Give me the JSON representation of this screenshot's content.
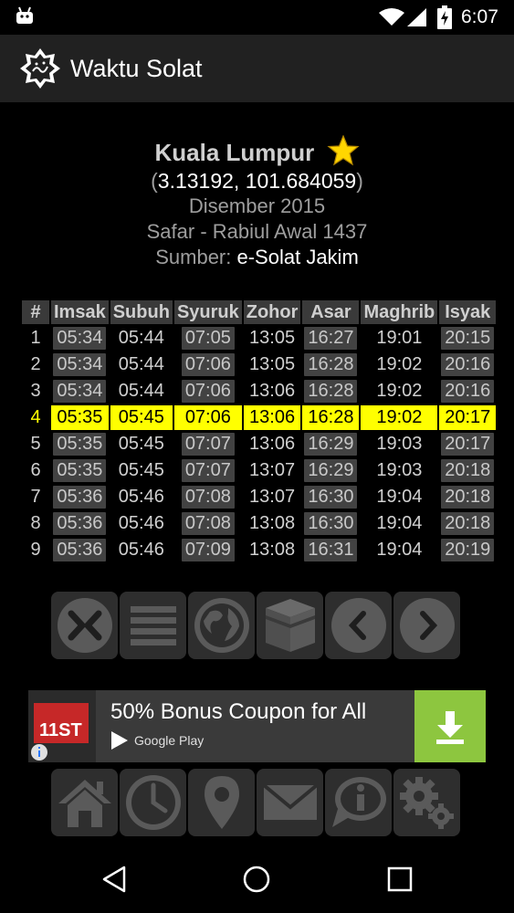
{
  "status_bar": {
    "time": "6:07"
  },
  "app_bar": {
    "title": "Waktu Solat"
  },
  "location": {
    "city": "Kuala Lumpur",
    "coordinates": "3.13192, 101.684059",
    "month": "Disember 2015",
    "hijri": "Safar - Rabiul Awal 1437",
    "source_label": "Sumber:",
    "source_value": "e-Solat Jakim"
  },
  "table": {
    "headers": [
      "#",
      "Imsak",
      "Subuh",
      "Syuruk",
      "Zohor",
      "Asar",
      "Maghrib",
      "Isyak"
    ],
    "rows": [
      [
        "1",
        "05:34",
        "05:44",
        "07:05",
        "13:05",
        "16:27",
        "19:01",
        "20:15"
      ],
      [
        "2",
        "05:34",
        "05:44",
        "07:06",
        "13:05",
        "16:28",
        "19:02",
        "20:16"
      ],
      [
        "3",
        "05:34",
        "05:44",
        "07:06",
        "13:06",
        "16:28",
        "19:02",
        "20:16"
      ],
      [
        "4",
        "05:35",
        "05:45",
        "07:06",
        "13:06",
        "16:28",
        "19:02",
        "20:17"
      ],
      [
        "5",
        "05:35",
        "05:45",
        "07:07",
        "13:06",
        "16:29",
        "19:03",
        "20:17"
      ],
      [
        "6",
        "05:35",
        "05:45",
        "07:07",
        "13:07",
        "16:29",
        "19:03",
        "20:18"
      ],
      [
        "7",
        "05:36",
        "05:46",
        "07:08",
        "13:07",
        "16:30",
        "19:04",
        "20:18"
      ],
      [
        "8",
        "05:36",
        "05:46",
        "07:08",
        "13:08",
        "16:30",
        "19:04",
        "20:18"
      ],
      [
        "9",
        "05:36",
        "05:46",
        "07:09",
        "13:08",
        "16:31",
        "19:04",
        "20:19"
      ]
    ],
    "highlight_row": 4,
    "highlight_color": "#ffff00"
  },
  "toolbar_top": [
    "close-icon",
    "menu-icon",
    "globe-icon",
    "kaaba-icon",
    "chevron-left-icon",
    "chevron-right-icon"
  ],
  "toolbar_bottom": [
    "home-icon",
    "clock-icon",
    "location-pin-icon",
    "mail-icon",
    "info-bubble-icon",
    "settings-gears-icon"
  ],
  "ad": {
    "title": "50% Bonus Coupon for All",
    "store_label": "Google Play",
    "accent_color": "#8dc63f"
  }
}
